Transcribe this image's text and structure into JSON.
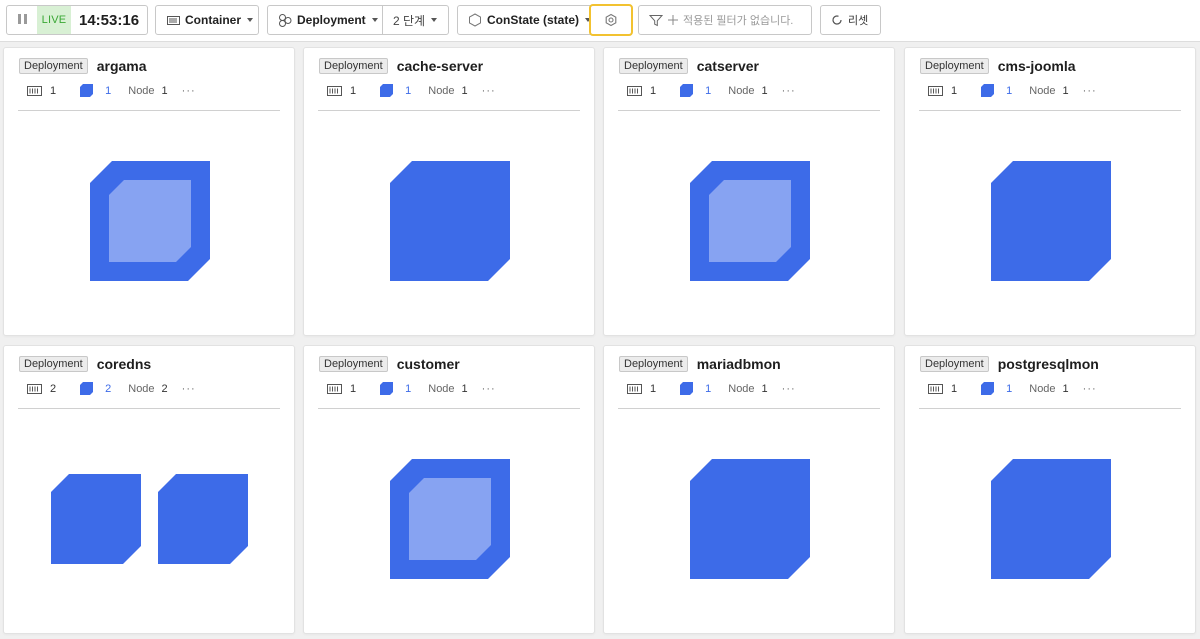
{
  "toolbar": {
    "live_label": "LIVE",
    "time": "14:53:16",
    "container_label": "Container",
    "deployment_label": "Deployment",
    "step_label": "2 단계",
    "state_label": "ConState (state)",
    "filter_placeholder": "적용된 필터가 없습니다.",
    "reset_label": "리셋"
  },
  "colors": {
    "pod_blue": "#3d6be8",
    "pod_light": "#87a3f2",
    "live_green": "#3aa735",
    "highlight_yellow": "#f2c230"
  },
  "cards": [
    {
      "type": "Deployment",
      "name": "argama",
      "containers": "1",
      "pods": "1",
      "node_label": "Node",
      "nodes": "1",
      "more": "···",
      "pod_style": "selected",
      "pod_count": 1
    },
    {
      "type": "Deployment",
      "name": "cache-server",
      "containers": "1",
      "pods": "1",
      "node_label": "Node",
      "nodes": "1",
      "more": "···",
      "pod_style": "plain",
      "pod_count": 1
    },
    {
      "type": "Deployment",
      "name": "catserver",
      "containers": "1",
      "pods": "1",
      "node_label": "Node",
      "nodes": "1",
      "more": "···",
      "pod_style": "selected",
      "pod_count": 1
    },
    {
      "type": "Deployment",
      "name": "cms-joomla",
      "containers": "1",
      "pods": "1",
      "node_label": "Node",
      "nodes": "1",
      "more": "···",
      "pod_style": "plain",
      "pod_count": 1
    },
    {
      "type": "Deployment",
      "name": "coredns",
      "containers": "2",
      "pods": "2",
      "node_label": "Node",
      "nodes": "2",
      "more": "···",
      "pod_style": "plain",
      "pod_count": 2
    },
    {
      "type": "Deployment",
      "name": "customer",
      "containers": "1",
      "pods": "1",
      "node_label": "Node",
      "nodes": "1",
      "more": "···",
      "pod_style": "selected",
      "pod_count": 1
    },
    {
      "type": "Deployment",
      "name": "mariadbmon",
      "containers": "1",
      "pods": "1",
      "node_label": "Node",
      "nodes": "1",
      "more": "···",
      "pod_style": "plain",
      "pod_count": 1
    },
    {
      "type": "Deployment",
      "name": "postgresqlmon",
      "containers": "1",
      "pods": "1",
      "node_label": "Node",
      "nodes": "1",
      "more": "···",
      "pod_style": "plain",
      "pod_count": 1
    }
  ]
}
